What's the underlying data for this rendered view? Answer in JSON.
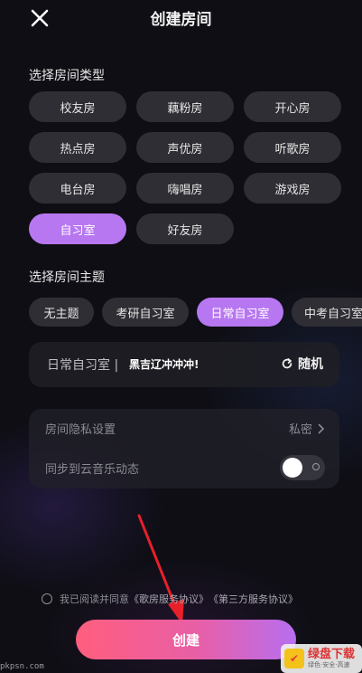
{
  "header": {
    "title": "创建房间"
  },
  "room_type": {
    "title": "选择房间类型",
    "options": [
      "校友房",
      "藕粉房",
      "开心房",
      "热点房",
      "声优房",
      "听歌房",
      "电台房",
      "嗨唱房",
      "游戏房",
      "自习室",
      "好友房"
    ],
    "selected": "自习室"
  },
  "theme": {
    "title": "选择房间主题",
    "options": [
      "无主题",
      "考研自习室",
      "日常自习室",
      "中考自习室"
    ],
    "selected": "日常自习室"
  },
  "room_name": {
    "prefix": "日常自习室 |",
    "value": "黑吉辽冲冲冲!"
  },
  "random": {
    "label": "随机",
    "icon": "refresh-icon"
  },
  "settings": {
    "privacy_label": "房间隐私设置",
    "privacy_value": "私密",
    "sync_label": "同步到云音乐动态",
    "sync_on": false
  },
  "agreement": {
    "prefix": "我已阅读并同意",
    "link1": "《歌房服务协议》",
    "link2": "《第三方服务协议》"
  },
  "create_label": "创建",
  "watermarks": {
    "left": "pkpsn.com",
    "right_main": "绿盘下载",
    "right_sub": "绿色·安全·高速"
  },
  "colors": {
    "accent": "#b777f0",
    "chip_bg": "#2e2e34",
    "button_start": "#ff5e7e",
    "button_end": "#b76ef0"
  }
}
